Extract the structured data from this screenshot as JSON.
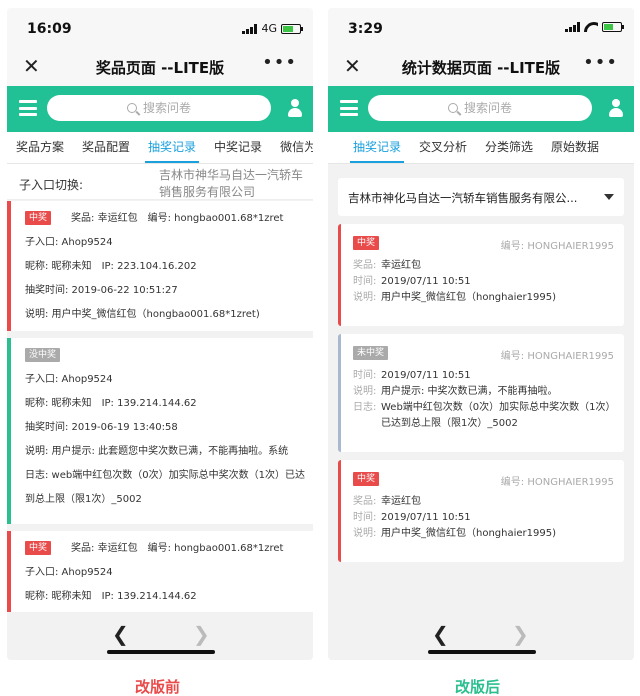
{
  "colors": {
    "green": "#22c095",
    "accent": "#1aa0dc",
    "red": "#e94b4b",
    "grey": "#aaaaaa"
  },
  "before": {
    "status": {
      "time": "16:09",
      "network": "4G"
    },
    "title": "奖品页面 --LITE版",
    "search_placeholder": "搜索问卷",
    "tabs": [
      "奖品方案",
      "奖品配置",
      "抽奖记录",
      "中奖记录",
      "微信为"
    ],
    "sub_entry": {
      "label": "子入口切换:",
      "value": "吉林市神华马自达一汽轿车销售服务有限公司"
    },
    "cards": [
      {
        "badge": "中奖",
        "prize_label": "奖品:",
        "prize": "幸运红包",
        "code_label": "编号:",
        "code": "hongbao001.68*1zret",
        "sub_entry": "子入口: Ahop9524",
        "nickname": "昵称: 昵称未知",
        "ip": "IP: 223.104.16.202",
        "time": "抽奖时间: 2019-06-22 10:51:27",
        "desc": "说明: 用户中奖_微信红包（hongbao001.68*1zret)"
      },
      {
        "badge": "没中奖",
        "sub_entry": "子入口: Ahop9524",
        "nickname": "昵称: 昵称未知",
        "ip": "IP: 139.214.144.62",
        "time": "抽奖时间: 2019-06-19 13:40:58",
        "desc": "说明: 用户提示: 此套题您中奖次数已满，不能再抽啦。系统",
        "log": "日志: web端中红包次数（0次）加实际总中奖次数（1次）已达到总上限（限1次）_5002"
      },
      {
        "badge": "中奖",
        "prize_label": "奖品:",
        "prize": "幸运红包",
        "code_label": "编号:",
        "code": "hongbao001.68*1zret",
        "sub_entry": "子入口: Ahop9524",
        "nickname": "昵称: 昵称未知",
        "ip": "IP: 139.214.144.62"
      }
    ],
    "caption": "改版前"
  },
  "after": {
    "status": {
      "time": "3:29"
    },
    "title": "统计数据页面 --LITE版",
    "search_placeholder": "搜索问卷",
    "tabs": [
      "抽奖记录",
      "交叉分析",
      "分类筛选",
      "原始数据"
    ],
    "dropdown": "吉林市神化马自达一汽轿车销售服务有限公...",
    "cards": [
      {
        "badge": "中奖",
        "code": "编号: HONGHAIER1995",
        "rows": [
          {
            "k": "奖品:",
            "v": "幸运红包"
          },
          {
            "k": "时间:",
            "v": "2019/07/11  10:51"
          },
          {
            "k": "说明:",
            "v": "用户中奖_微信红包（honghaier1995)"
          }
        ]
      },
      {
        "badge": "未中奖",
        "code": "编号: HONGHAIER1995",
        "rows": [
          {
            "k": "时间:",
            "v": "2019/07/11  10:51"
          },
          {
            "k": "说明:",
            "v": "用户提示: 中奖次数已满，不能再抽啦。"
          },
          {
            "k": "日志:",
            "v": "Web端中红包次数（0次）加实际总中奖次数（1次）已达到总上限（限1次）_5002"
          }
        ]
      },
      {
        "badge": "中奖",
        "code": "编号: HONGHAIER1995",
        "rows": [
          {
            "k": "奖品:",
            "v": "幸运红包"
          },
          {
            "k": "时间:",
            "v": "2019/07/11  10:51"
          },
          {
            "k": "说明:",
            "v": "用户中奖_微信红包（honghaier1995)"
          }
        ]
      }
    ],
    "caption": "改版后"
  }
}
